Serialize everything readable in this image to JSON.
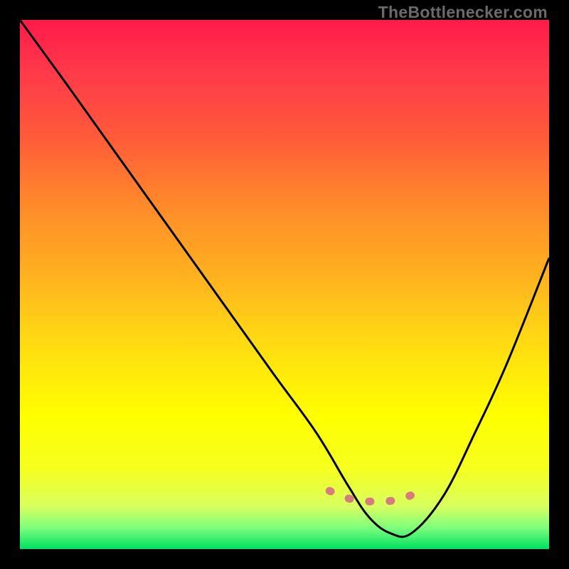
{
  "watermark": "TheBottlenecker.com",
  "chart_data": {
    "type": "line",
    "title": "",
    "xlabel": "",
    "ylabel": "",
    "xlim": [
      0,
      100
    ],
    "ylim": [
      0,
      100
    ],
    "grid": false,
    "legend": false,
    "background_gradient": {
      "stops": [
        {
          "pos": 0,
          "color": "#ff1a4a"
        },
        {
          "pos": 22,
          "color": "#ff5a3a"
        },
        {
          "pos": 48,
          "color": "#ffb020"
        },
        {
          "pos": 75,
          "color": "#ffff00"
        },
        {
          "pos": 96,
          "color": "#7cff7c"
        },
        {
          "pos": 100,
          "color": "#00e060"
        }
      ]
    },
    "series": [
      {
        "name": "bottleneck-curve",
        "x": [
          0,
          8,
          18,
          28,
          38,
          48,
          56,
          62,
          66,
          70,
          74,
          80,
          86,
          92,
          100
        ],
        "y": [
          100,
          89,
          75,
          61,
          47,
          33,
          22,
          12,
          6,
          3,
          3,
          10,
          22,
          35,
          55
        ],
        "stroke": "#000000"
      },
      {
        "name": "optimal-zone-marker",
        "x": [
          58.5,
          60.5,
          62.0,
          64.0,
          66.0,
          68.0,
          70.0,
          72.0,
          73.5,
          75.5
        ],
        "y": [
          11.0,
          10.2,
          9.6,
          9.2,
          9.0,
          9.0,
          9.1,
          9.4,
          10.0,
          10.8
        ],
        "stroke": "#d77c7c",
        "style": "dashed"
      }
    ]
  }
}
